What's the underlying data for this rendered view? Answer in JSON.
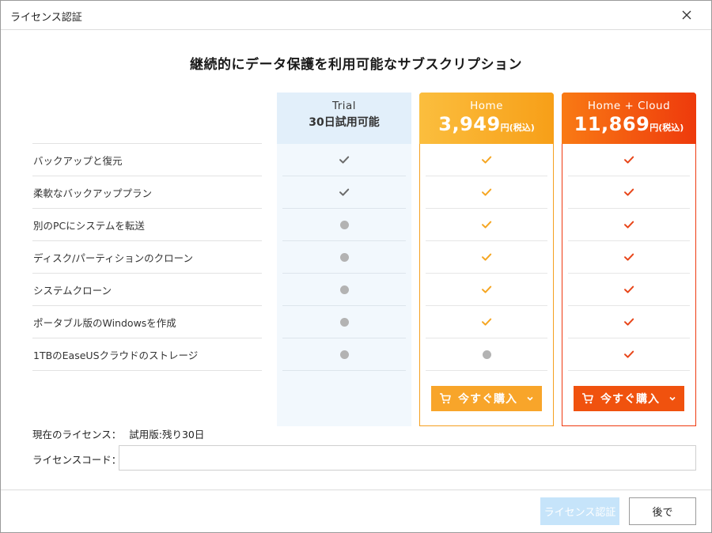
{
  "window": {
    "title": "ライセンス認証"
  },
  "heading": "継続的にデータ保護を利用可能なサブスクリプション",
  "features": [
    "バックアップと復元",
    "柔軟なバックアッププラン",
    "別のPCにシステムを転送",
    "ディスク/パーティションのクローン",
    "システムクローン",
    "ポータブル版のWindowsを作成",
    "1TBのEaseUSクラウドのストレージ"
  ],
  "plans": {
    "trial": {
      "name": "Trial",
      "subtitle": "30日試用可能",
      "availability": [
        "check",
        "check",
        "dot",
        "dot",
        "dot",
        "dot",
        "dot"
      ]
    },
    "home": {
      "name": "Home",
      "price": "3,949",
      "price_unit": "円(税込)",
      "buy_label": "今すぐ購入",
      "availability": [
        "check",
        "check",
        "check",
        "check",
        "check",
        "check",
        "dot"
      ]
    },
    "cloud": {
      "name": "Home + Cloud",
      "price": "11,869",
      "price_unit": "円(税込)",
      "buy_label": "今すぐ購入",
      "availability": [
        "check",
        "check",
        "check",
        "check",
        "check",
        "check",
        "check"
      ]
    }
  },
  "license": {
    "current_label": "現在のライセンス：",
    "current_value": "試用版:残り30日",
    "code_label": "ライセンスコード：",
    "code_value": ""
  },
  "footer": {
    "activate_label": "ライセンス認証",
    "later_label": "後で"
  },
  "colors": {
    "trial_check": "#6b6b6b",
    "home_check": "#f5a623",
    "cloud_check": "#e8461a",
    "dot": "#b3b3b3",
    "home_accent": "#f8a52a",
    "cloud_accent": "#f0520e"
  },
  "icons": {
    "close": "close-icon",
    "check": "check-icon",
    "unavailable": "dot-icon",
    "cart": "cart-icon",
    "dropdown": "chevron-down-icon"
  }
}
